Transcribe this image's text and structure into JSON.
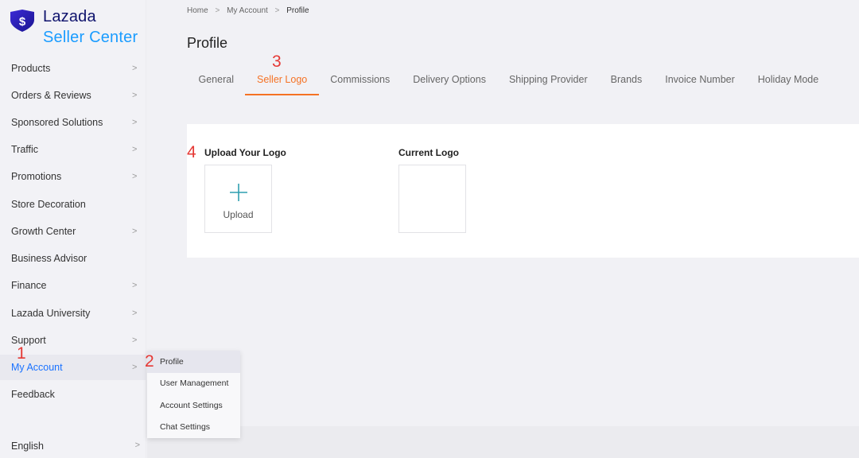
{
  "brand": {
    "name": "Lazada",
    "product": "Seller Center",
    "badge_letter": "$",
    "primary_color": "#0f136d",
    "accent_color": "#1a9cff"
  },
  "sidebar": {
    "items": [
      {
        "label": "Products",
        "has_chevron": true
      },
      {
        "label": "Orders & Reviews",
        "has_chevron": true
      },
      {
        "label": "Sponsored Solutions",
        "has_chevron": true
      },
      {
        "label": "Traffic",
        "has_chevron": true
      },
      {
        "label": "Promotions",
        "has_chevron": true
      },
      {
        "label": "Store Decoration",
        "has_chevron": false
      },
      {
        "label": "Growth Center",
        "has_chevron": true
      },
      {
        "label": "Business Advisor",
        "has_chevron": false
      },
      {
        "label": "Finance",
        "has_chevron": true
      },
      {
        "label": "Lazada University",
        "has_chevron": true
      },
      {
        "label": "Support",
        "has_chevron": true
      },
      {
        "label": "My Account",
        "has_chevron": true,
        "active": true
      },
      {
        "label": "Feedback",
        "has_chevron": false
      }
    ],
    "language": "English"
  },
  "submenu": {
    "items": [
      "Profile",
      "User Management",
      "Account Settings",
      "Chat Settings"
    ],
    "active": "Profile"
  },
  "annotations": {
    "one": "1",
    "two": "2",
    "three": "3",
    "four": "4",
    "color": "#e53935"
  },
  "breadcrumb": {
    "home": "Home",
    "sep1": ">",
    "account": "My Account",
    "sep2": ">",
    "current": "Profile"
  },
  "page_title": "Profile",
  "tabs": [
    {
      "label": "General"
    },
    {
      "label": "Seller Logo",
      "active": true
    },
    {
      "label": "Commissions"
    },
    {
      "label": "Delivery Options"
    },
    {
      "label": "Shipping Provider"
    },
    {
      "label": "Brands"
    },
    {
      "label": "Invoice Number"
    },
    {
      "label": "Holiday Mode"
    }
  ],
  "tab_active_color": "#f57224",
  "logo_section": {
    "upload_label": "Upload Your Logo",
    "upload_button": "Upload",
    "current_label": "Current Logo",
    "plus_icon": "plus-icon",
    "plus_color": "#2f9fb0"
  }
}
